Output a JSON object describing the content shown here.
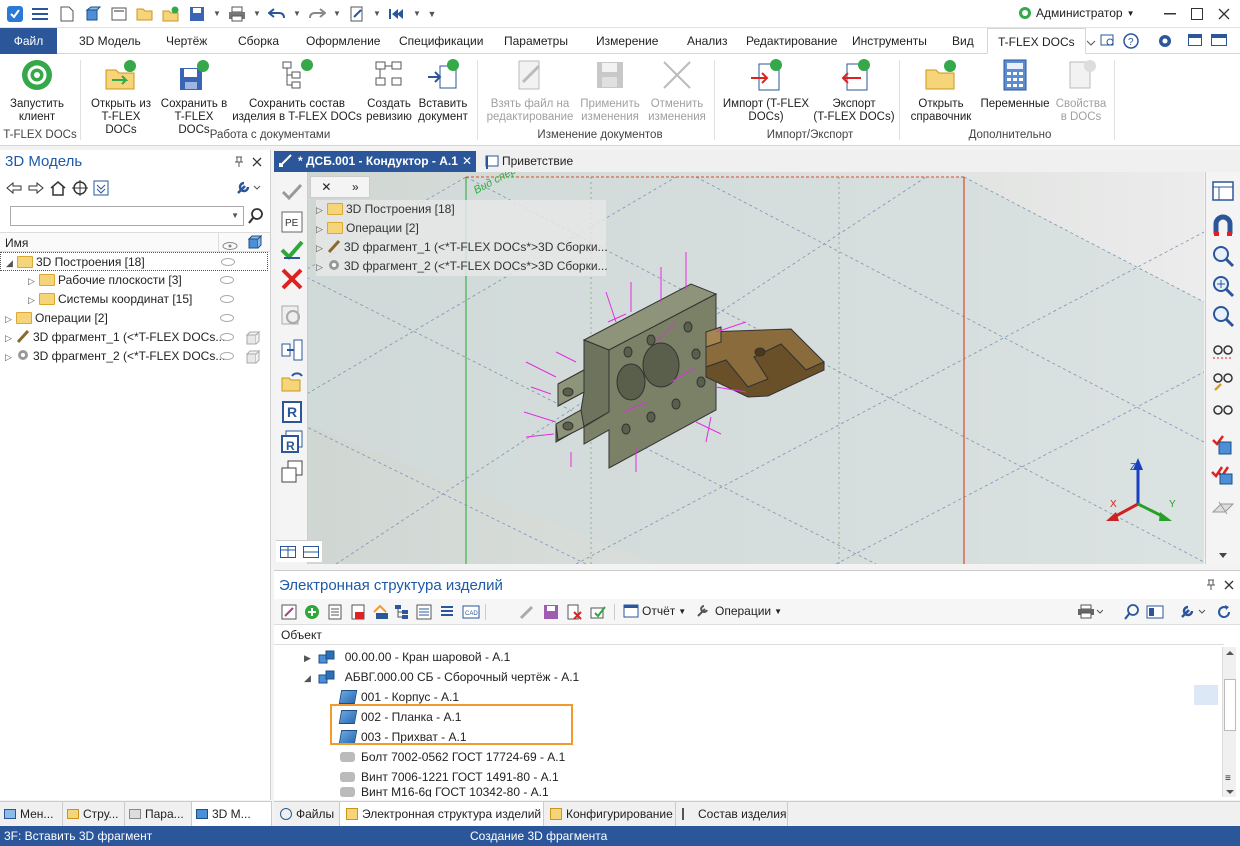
{
  "user": "Администратор",
  "tabs": [
    "Файл",
    "3D Модель",
    "Чертёж",
    "Сборка",
    "Оформление",
    "Спецификации",
    "Параметры",
    "Измерение",
    "Анализ",
    "Редактирование",
    "Инструменты",
    "Вид",
    "T-FLEX DOCs"
  ],
  "ribbon": {
    "buttons": [
      {
        "label1": "Запустить",
        "label2": "клиент"
      },
      {
        "label1": "Открыть из",
        "label2": "T-FLEX DOCs"
      },
      {
        "label1": "Сохранить в",
        "label2": "T-FLEX DOCs"
      },
      {
        "label1": "Сохранить состав",
        "label2": "изделия в T-FLEX DOCs"
      },
      {
        "label1": "Создать",
        "label2": "ревизию"
      },
      {
        "label1": "Вставить",
        "label2": "документ"
      },
      {
        "label1": "Взять файл на",
        "label2": "редактирование"
      },
      {
        "label1": "Применить",
        "label2": "изменения"
      },
      {
        "label1": "Отменить",
        "label2": "изменения"
      },
      {
        "label1": "Импорт (T-FLEX",
        "label2": "DOCs)"
      },
      {
        "label1": "Экспорт",
        "label2": "(T-FLEX DOCs)"
      },
      {
        "label1": "Открыть",
        "label2": "справочник"
      },
      {
        "label1": "Переменные",
        "label2": ""
      },
      {
        "label1": "Свойства",
        "label2": "в DOCs"
      }
    ],
    "groups": [
      "T-FLEX DOCs",
      "Работа с документами",
      "Изменение документов",
      "Импорт/Экспорт",
      "Дополнительно"
    ]
  },
  "left_panel": {
    "title": "3D Модель",
    "column_name": "Имя",
    "tree": [
      "3D Построения [18]",
      "Рабочие плоскости [3]",
      "Системы координат [15]",
      "Операции [2]",
      "3D фрагмент_1 (<*T-FLEX DOCs...",
      "3D фрагмент_2 (<*T-FLEX DOCs..."
    ],
    "bottom_tabs": [
      "Мен...",
      "Стру...",
      "Пара...",
      "3D М..."
    ]
  },
  "doc_tabs": [
    "* ДСБ.001 - Кондуктор - А.1",
    "Приветствие"
  ],
  "viewport": {
    "view_label": "Вид спереди",
    "tree": [
      "3D Построения [18]",
      "Операции [2]",
      "3D фрагмент_1 (<*T-FLEX DOCs*>3D Сборки...",
      "3D фрагмент_2 (<*T-FLEX DOCs*>3D Сборки..."
    ],
    "axes": {
      "x": "X",
      "y": "Y",
      "z": "Z"
    }
  },
  "edi": {
    "title": "Электронная структура изделий",
    "toolbar": {
      "report": "Отчёт",
      "operations": "Операции"
    },
    "column": "Объект",
    "rows": [
      "00.00.00 - Кран шаровой - А.1",
      "АБВГ.000.00 СБ - Сборочный чертёж - А.1",
      "001 - Корпус - А.1",
      "002 - Планка - А.1",
      "003 - Прихват - А.1",
      "Болт 7002-0562 ГОСТ 17724-69 - А.1",
      "Винт 7006-1221 ГОСТ 1491-80 - А.1",
      "Винт M16-6g ГОСТ 10342-80 - А.1"
    ],
    "bottom_tabs": [
      "Файлы",
      "Электронная структура изделий",
      "Конфигурирование",
      "Состав изделия"
    ]
  },
  "status": {
    "left": "3F: Вставить 3D фрагмент",
    "center": "Создание 3D фрагмента"
  },
  "colors": {
    "accent": "#2b579a",
    "highlight": "#f39a2d",
    "docs_green": "#35a84a"
  }
}
